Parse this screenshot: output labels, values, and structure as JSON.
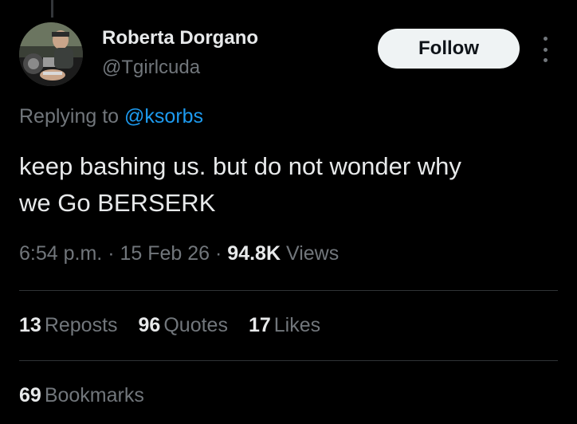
{
  "author": {
    "display_name": "Roberta Dorgano",
    "handle": "@Tgirlcuda"
  },
  "follow_label": "Follow",
  "reply_context": {
    "prefix": "Replying to",
    "mention": "@ksorbs"
  },
  "tweet": {
    "line1": "keep bashing us. but do not wonder why",
    "line2": "we Go BERSERK"
  },
  "meta": {
    "time": "6:54 p.m.",
    "separator": "·",
    "date": "15 Feb 26",
    "views_count": "94.8K",
    "views_label": "Views"
  },
  "stats": {
    "reposts_count": "13",
    "reposts_label": "Reposts",
    "quotes_count": "96",
    "quotes_label": "Quotes",
    "likes_count": "17",
    "likes_label": "Likes",
    "bookmarks_count": "69",
    "bookmarks_label": "Bookmarks"
  },
  "icons": {
    "more": "vertical-ellipsis-icon",
    "avatar": "user-avatar"
  },
  "colors": {
    "background": "#000000",
    "primary_text": "#e7e9ea",
    "secondary_text": "#71767b",
    "link": "#1d9bf0",
    "follow_button_bg": "#eff3f4",
    "divider": "#2f3336"
  }
}
